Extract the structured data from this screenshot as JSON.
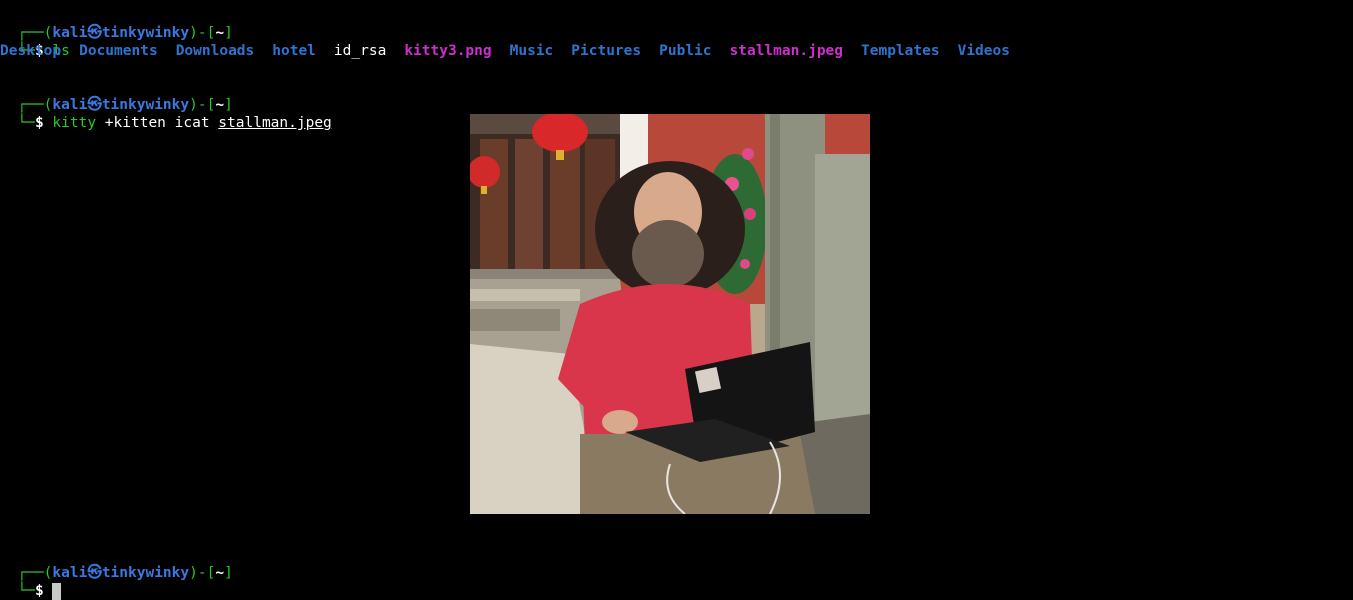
{
  "prompt": {
    "open": "┌──(",
    "user": "kali",
    "at": "㉿",
    "host": "tinkywinky",
    "mid": ")-[",
    "path": "~",
    "close": "]",
    "line2": "└─",
    "symbol": "$"
  },
  "commands": {
    "cmd1": "ls",
    "cmd2_program": "kitty",
    "cmd2_args": "+kitten icat",
    "cmd2_file": "stallman.jpeg"
  },
  "ls_output": [
    {
      "name": "Desktop",
      "kind": "dir"
    },
    {
      "name": "Documents",
      "kind": "dir"
    },
    {
      "name": "Downloads",
      "kind": "dir"
    },
    {
      "name": "hotel",
      "kind": "dir"
    },
    {
      "name": "id_rsa",
      "kind": "file"
    },
    {
      "name": "kitty3.png",
      "kind": "image"
    },
    {
      "name": "Music",
      "kind": "dir"
    },
    {
      "name": "Pictures",
      "kind": "dir"
    },
    {
      "name": "Public",
      "kind": "dir"
    },
    {
      "name": "stallman.jpeg",
      "kind": "image"
    },
    {
      "name": "Templates",
      "kind": "dir"
    },
    {
      "name": "Videos",
      "kind": "dir"
    }
  ],
  "colors": {
    "background": "#000000",
    "prompt_green": "#28c828",
    "user_blue": "#3a79e0",
    "dir_blue": "#2f74d0",
    "image_magenta": "#cc2fcc"
  }
}
